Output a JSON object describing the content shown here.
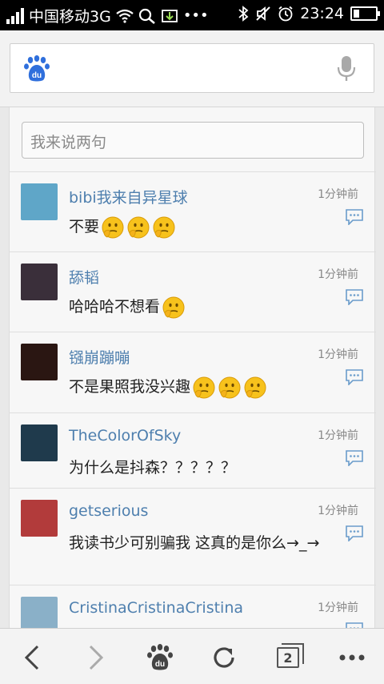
{
  "status_bar": {
    "carrier": "中国移动3G",
    "time": "23:24",
    "battery_fraction": 0.25,
    "icons": [
      "signal-icon",
      "wifi-icon",
      "search-icon",
      "download-icon",
      "more-icon",
      "bluetooth-icon",
      "mute-icon",
      "alarm-icon",
      "battery-icon"
    ]
  },
  "search": {
    "logo": "baidu-paw-icon",
    "voice_icon": "microphone-icon"
  },
  "comment_box": {
    "placeholder": "我来说两句"
  },
  "comments": [
    {
      "user": "bibi我来自异星球",
      "time": "1分钟前",
      "text": "不要",
      "emoji_count": 3,
      "avatar_color": "#5fa6c8"
    },
    {
      "user": "舔韬",
      "time": "1分钟前",
      "text": "哈哈哈不想看",
      "emoji_count": 1,
      "avatar_color": "#3a2f3a"
    },
    {
      "user": "镪崩蹦嘣",
      "time": "1分钟前",
      "text": "不是果照我没兴趣",
      "emoji_count": 3,
      "avatar_color": "#2a1612"
    },
    {
      "user": "TheColorOfSky",
      "time": "1分钟前",
      "text": "为什么是抖森？？？？？",
      "emoji_count": 0,
      "avatar_color": "#1f3a4c"
    },
    {
      "user": "getserious",
      "time": "1分钟前",
      "text": "我读书少可别骗我 这真的是你么→_→",
      "emoji_count": 0,
      "avatar_color": "#b23b3b"
    },
    {
      "user": "CristinaCristinaCristina",
      "time": "1分钟前",
      "text": "",
      "emoji_count": 0,
      "avatar_color": "#8ab0c8"
    }
  ],
  "toolbar": {
    "tab_count": "2",
    "icons": [
      "back-icon",
      "forward-icon",
      "baidu-home-icon",
      "refresh-icon",
      "tabs-icon",
      "menu-icon"
    ]
  },
  "colors": {
    "username": "#4e7fae",
    "reply_icon": "#6a9ccb",
    "emoji": "#f7c21c"
  }
}
